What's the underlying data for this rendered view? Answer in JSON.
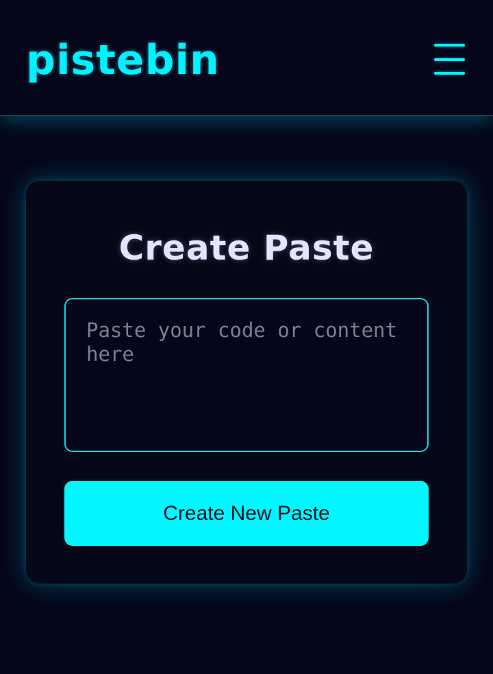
{
  "header": {
    "logo": "pistebin",
    "menu_icon": "hamburger-menu-icon"
  },
  "card": {
    "title": "Create Paste",
    "input": {
      "value": "",
      "placeholder": "Paste your code or content here"
    },
    "submit_label": "Create New Paste"
  },
  "colors": {
    "background": "#05061a",
    "accent": "#00f2ff",
    "button": "#00f7ff",
    "title": "#e6e4fb",
    "card": "#070817"
  }
}
